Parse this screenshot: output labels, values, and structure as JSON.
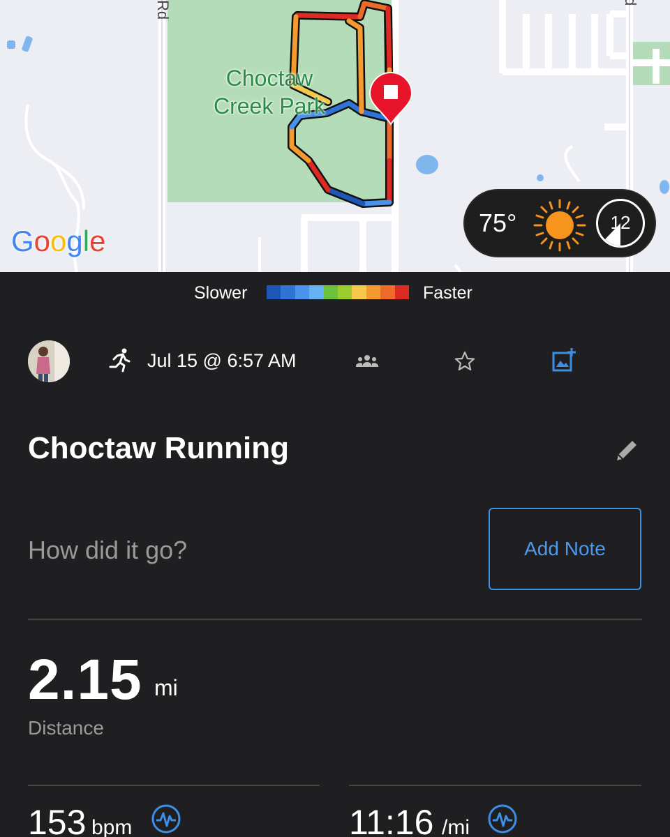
{
  "map": {
    "park_name_line1": "Choctaw",
    "park_name_line2": "Creek Park",
    "road_label_left": "Rd",
    "road_label_right": "d",
    "provider": "Google",
    "colors": {
      "park": "#b5dcb8",
      "background": "#eceef3",
      "water": "#7fb6ee",
      "marker": "#e8152a"
    }
  },
  "weather": {
    "temperature": "75°",
    "icon": "sun-icon",
    "moon_day": "12"
  },
  "legend": {
    "slower_label": "Slower",
    "faster_label": "Faster",
    "colors": [
      "#1e56b5",
      "#2f73d6",
      "#4a93ea",
      "#67b3f2",
      "#6cc23c",
      "#9ccd2f",
      "#f5c84a",
      "#f49a2e",
      "#ee6a2a",
      "#dd2a22"
    ]
  },
  "activity": {
    "type_icon": "running-icon",
    "date": "Jul 15 @ 6:57 AM",
    "title": "Choctaw Running",
    "note_prompt": "How did it go?",
    "add_note_label": "Add Note"
  },
  "stats": {
    "distance": {
      "value": "2.15",
      "unit": "mi",
      "label": "Distance"
    },
    "heart_rate": {
      "value": "153",
      "unit": "bpm"
    },
    "pace": {
      "value": "11:16",
      "unit": "/mi"
    }
  },
  "accent_color": "#3d8fe6"
}
